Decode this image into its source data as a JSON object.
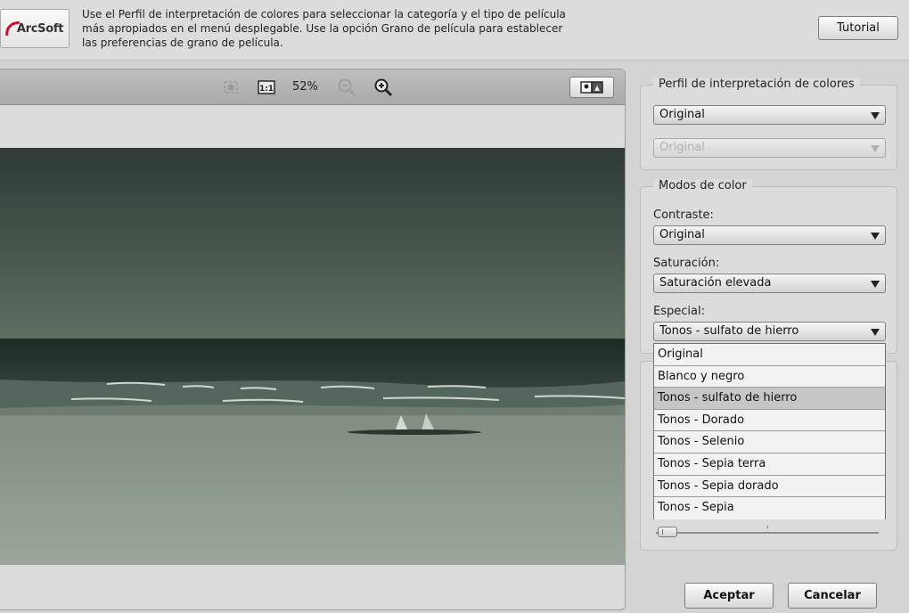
{
  "header": {
    "logo_text": "ArcSoft",
    "description": "Use el Perfil de interpretación de colores para seleccionar la categoría y el tipo de película\n más apropiados en el menú desplegable.  Use la opción Grano de película para establecer\nlas preferencias de grano de película.",
    "tutorial_label": "Tutorial"
  },
  "preview": {
    "zoom_level": "52%"
  },
  "color_profile": {
    "title": "Perfil de interpretación de colores",
    "category_value": "Original",
    "type_value": "Original"
  },
  "color_modes": {
    "title": "Modos de color",
    "contrast_label": "Contraste:",
    "contrast_value": "Original",
    "saturation_label": "Saturación:",
    "saturation_value": "Saturación elevada",
    "special_label": "Especial:",
    "special_value": "Tonos - sulfato de hierro",
    "special_options": [
      "Original",
      "Blanco y negro",
      "Tonos - sulfato de hierro",
      "Tonos - Dorado",
      "Tonos - Selenio",
      "Tonos - Sepia terra",
      "Tonos - Sepia dorado",
      "Tonos - Sepia"
    ],
    "selected_index": 2
  },
  "film_grain": {
    "level": 0
  },
  "footer": {
    "accept_label": "Aceptar",
    "cancel_label": "Cancelar"
  },
  "colors": {
    "sky": "#4f5f53",
    "sea": "#2a3a33",
    "sand": "#8f9c8e",
    "brand_red": "#c8102e"
  }
}
